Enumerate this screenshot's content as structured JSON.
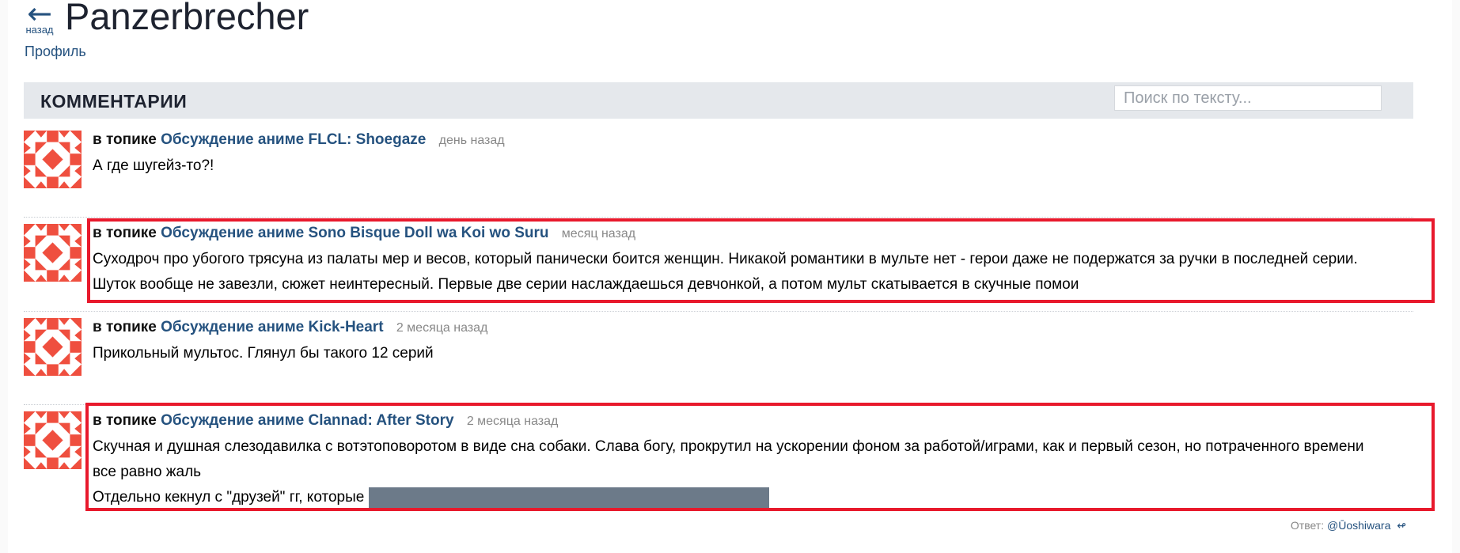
{
  "header": {
    "back_label": "назад",
    "title": "Panzerbrecher",
    "profile_link": "Профиль"
  },
  "comments_section": {
    "title": "КОММЕНТАРИИ",
    "search_placeholder": "Поиск по тексту..."
  },
  "comments": [
    {
      "prefix": "в топике",
      "topic": "Обсуждение аниме FLCL: Shoegaze",
      "time": "день назад",
      "lines": [
        "А где шугейз-то?!"
      ]
    },
    {
      "prefix": "в топике",
      "topic": "Обсуждение аниме Sono Bisque Doll wa Koi wo Suru",
      "time": "месяц назад",
      "lines": [
        "Суходроч про убогого трясуна из палаты мер и весов, который панически боится женщин. Никакой романтики в мульте нет - герои даже не подержатся за ручки в последней серии.",
        "Шуток вообще не завезли, сюжет неинтересный. Первые две серии наслаждаешься девчонкой, а потом мульт скатывается в скучные помои"
      ]
    },
    {
      "prefix": "в топике",
      "topic": "Обсуждение аниме Kick-Heart",
      "time": "2 месяца назад",
      "lines": [
        "Прикольный мультос. Глянул бы такого 12 серий"
      ]
    },
    {
      "prefix": "в топике",
      "topic": "Обсуждение аниме Clannad: After Story",
      "time": "2 месяца назад",
      "lines": [
        "Скучная и душная слезодавилка с вотэтоповоротом в виде сна собаки. Слава богу, прокрутил на ускорении фоном за работой/играми, как и первый сезон, но потраченного времени",
        "все равно жаль",
        "Отдельно кекнул с \"друзей\" гг, которые"
      ],
      "reply_prefix": "Ответ:",
      "reply_user": "@Ūoshiwara",
      "reply_icon": "reply-icon"
    }
  ],
  "colors": {
    "link": "#25527f",
    "highlight": "#e8192c",
    "avatar": "#ef4f3f",
    "header_bg": "#e5e8ec",
    "spoiler": "#6c7a89"
  }
}
